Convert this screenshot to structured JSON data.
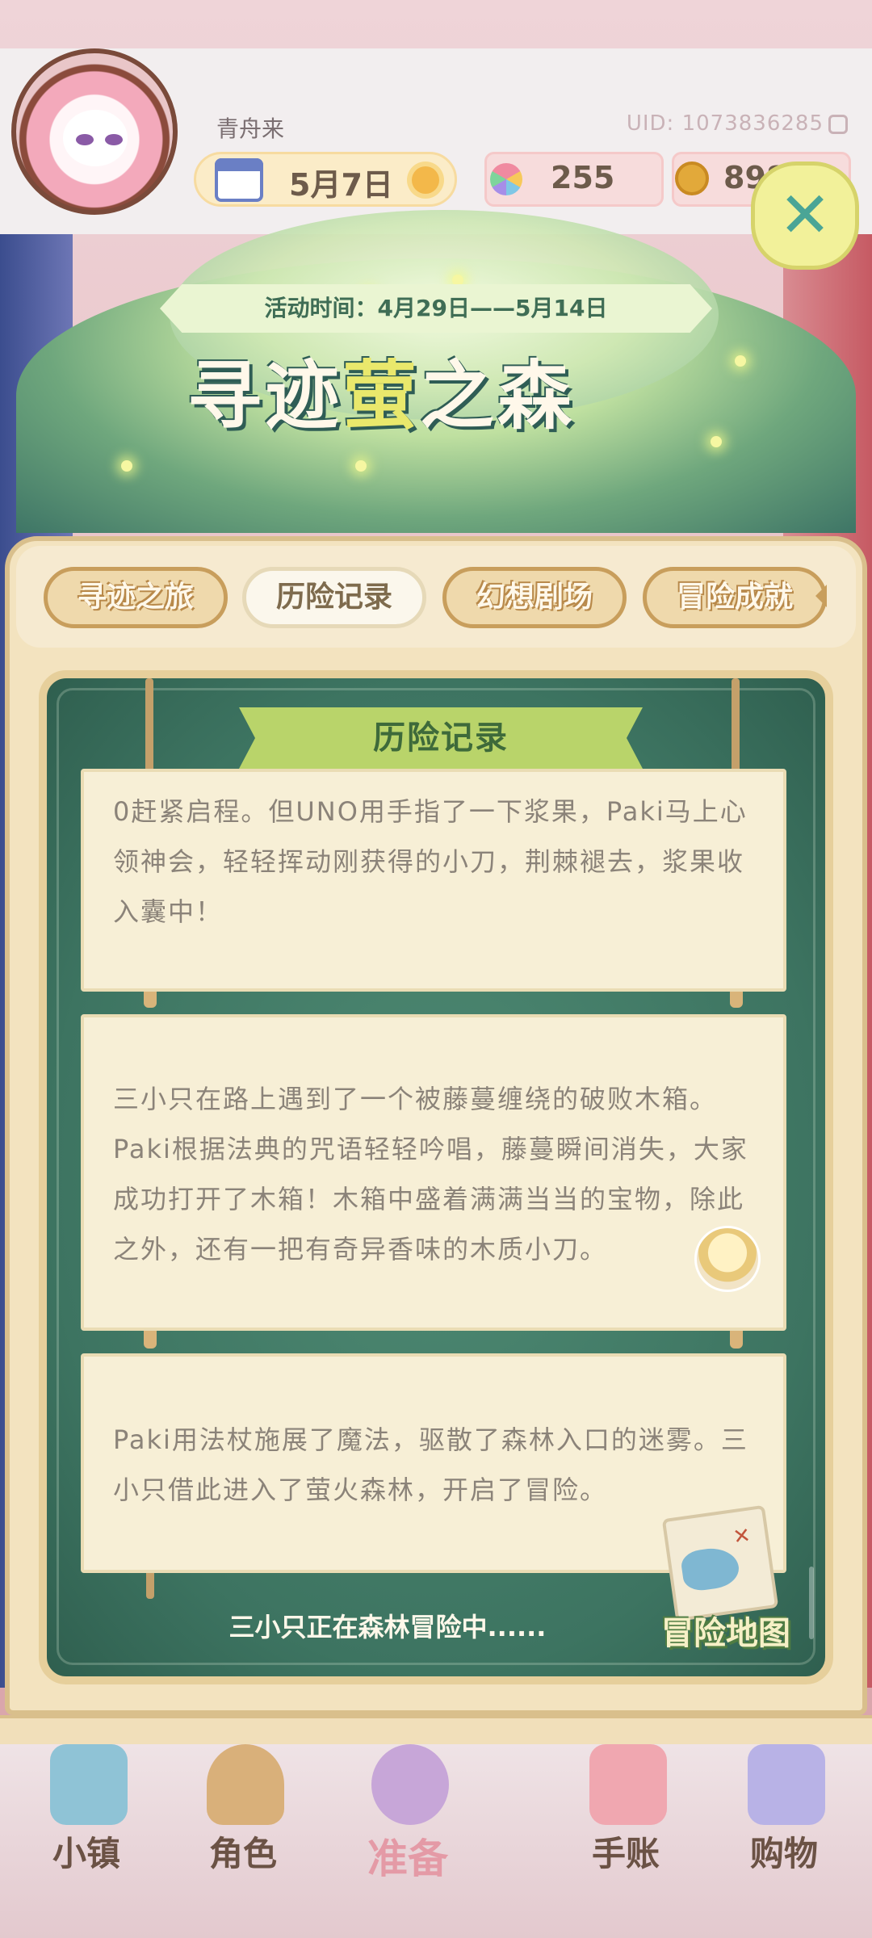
{
  "player": {
    "name": "青舟来",
    "uid": "UID: 1073836285"
  },
  "resources": {
    "date": "5月7日",
    "flowers": "255",
    "coins": "8984"
  },
  "event": {
    "title_part1": "寻迹",
    "title_part2": "萤",
    "title_part3": "之森",
    "time": "活动时间：4月29日——5月14日"
  },
  "tabs": [
    {
      "label": "寻迹之旅"
    },
    {
      "label": "历险记录"
    },
    {
      "label": "幻想剧场"
    },
    {
      "label": "冒险成就"
    }
  ],
  "board": {
    "title": "历险记录",
    "entries": [
      {
        "text": "0赶紧启程。但UNO用手指了一下浆果，Paki马上心领神会，轻轻挥动刚获得的小刀，荆棘褪去，浆果收入囊中！"
      },
      {
        "text": "三小只在路上遇到了一个被藤蔓缠绕的破败木箱。Paki根据法典的咒语轻轻吟唱，藤蔓瞬间消失，大家成功打开了木箱！木箱中盛着满满当当的宝物，除此之外，还有一把有奇异香味的木质小刀。"
      },
      {
        "text": "Paki用法杖施展了魔法，驱散了森林入口的迷雾。三小只借此进入了萤火森林，开启了冒险。"
      }
    ],
    "status": "三小只正在森林冒险中......",
    "map_label": "冒险地图"
  },
  "nav": [
    {
      "label": "小镇"
    },
    {
      "label": "角色"
    },
    {
      "label": "准备"
    },
    {
      "label": "手账"
    },
    {
      "label": "购物"
    }
  ],
  "colors": {
    "board_green": "#3d7461",
    "card_bg": "#f7efd6",
    "tab_active_text": "#7e6b4d",
    "title_yellow": "#e9e86c"
  }
}
